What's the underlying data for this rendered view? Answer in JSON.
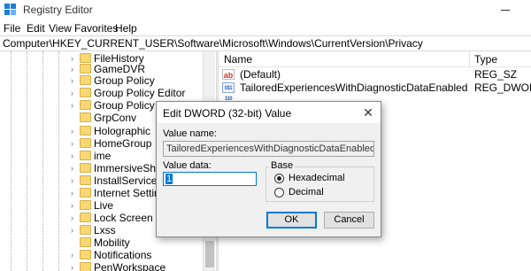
{
  "window": {
    "title": "Registry Editor"
  },
  "menu": [
    "File",
    "Edit",
    "View",
    "Favorites",
    "Help"
  ],
  "address": "Computer\\HKEY_CURRENT_USER\\Software\\Microsoft\\Windows\\CurrentVersion\\Privacy",
  "tree": {
    "items": [
      {
        "label": "FileHistory",
        "icon": "folder-icon",
        "expandable": true
      },
      {
        "label": "GameDVR",
        "icon": "folder-icon",
        "expandable": true
      },
      {
        "label": "Group Policy",
        "icon": "folder-icon",
        "expandable": true
      },
      {
        "label": "Group Policy Editor",
        "icon": "folder-icon",
        "expandable": true
      },
      {
        "label": "Group Policy Obje",
        "icon": "folder-icon",
        "expandable": true
      },
      {
        "label": "GrpConv",
        "icon": "folder-icon",
        "expandable": false
      },
      {
        "label": "Holographic",
        "icon": "folder-icon",
        "expandable": true
      },
      {
        "label": "HomeGroup",
        "icon": "folder-icon",
        "expandable": true
      },
      {
        "label": "ime",
        "icon": "folder-icon",
        "expandable": true
      },
      {
        "label": "ImmersiveShell",
        "icon": "folder-icon",
        "expandable": true
      },
      {
        "label": "InstallService",
        "icon": "folder-icon",
        "expandable": true
      },
      {
        "label": "Internet Settings",
        "icon": "folder-icon",
        "expandable": true
      },
      {
        "label": "Live",
        "icon": "folder-icon",
        "expandable": true
      },
      {
        "label": "Lock Screen",
        "icon": "folder-icon",
        "expandable": true
      },
      {
        "label": "Lxss",
        "icon": "folder-icon",
        "expandable": true
      },
      {
        "label": "Mobility",
        "icon": "folder-icon",
        "expandable": false
      },
      {
        "label": "Notifications",
        "icon": "folder-icon",
        "expandable": true
      },
      {
        "label": "PenWorkspace",
        "icon": "folder-icon",
        "expandable": true
      }
    ]
  },
  "values": {
    "header": {
      "name": "Name",
      "type": "Type"
    },
    "rows": [
      {
        "name": "(Default)",
        "type": "REG_SZ",
        "icon": "string-value-icon",
        "glyph": "ab"
      },
      {
        "name": "TailoredExperiencesWithDiagnosticDataEnabled",
        "type": "REG_DWORD",
        "icon": "dword-value-icon",
        "glyph": "011 110"
      }
    ]
  },
  "dialog": {
    "title": "Edit DWORD (32-bit) Value",
    "value_name_label": "Value name:",
    "value_name": "TailoredExperiencesWithDiagnosticDataEnabled",
    "value_data_label": "Value data:",
    "value_data": "1",
    "base_label": "Base",
    "base_options": [
      {
        "label": "Hexadecimal",
        "selected": true
      },
      {
        "label": "Decimal",
        "selected": false
      }
    ],
    "ok_label": "OK",
    "cancel_label": "Cancel"
  },
  "colors": {
    "accent": "#0078d7",
    "folder": "#f8d775"
  }
}
